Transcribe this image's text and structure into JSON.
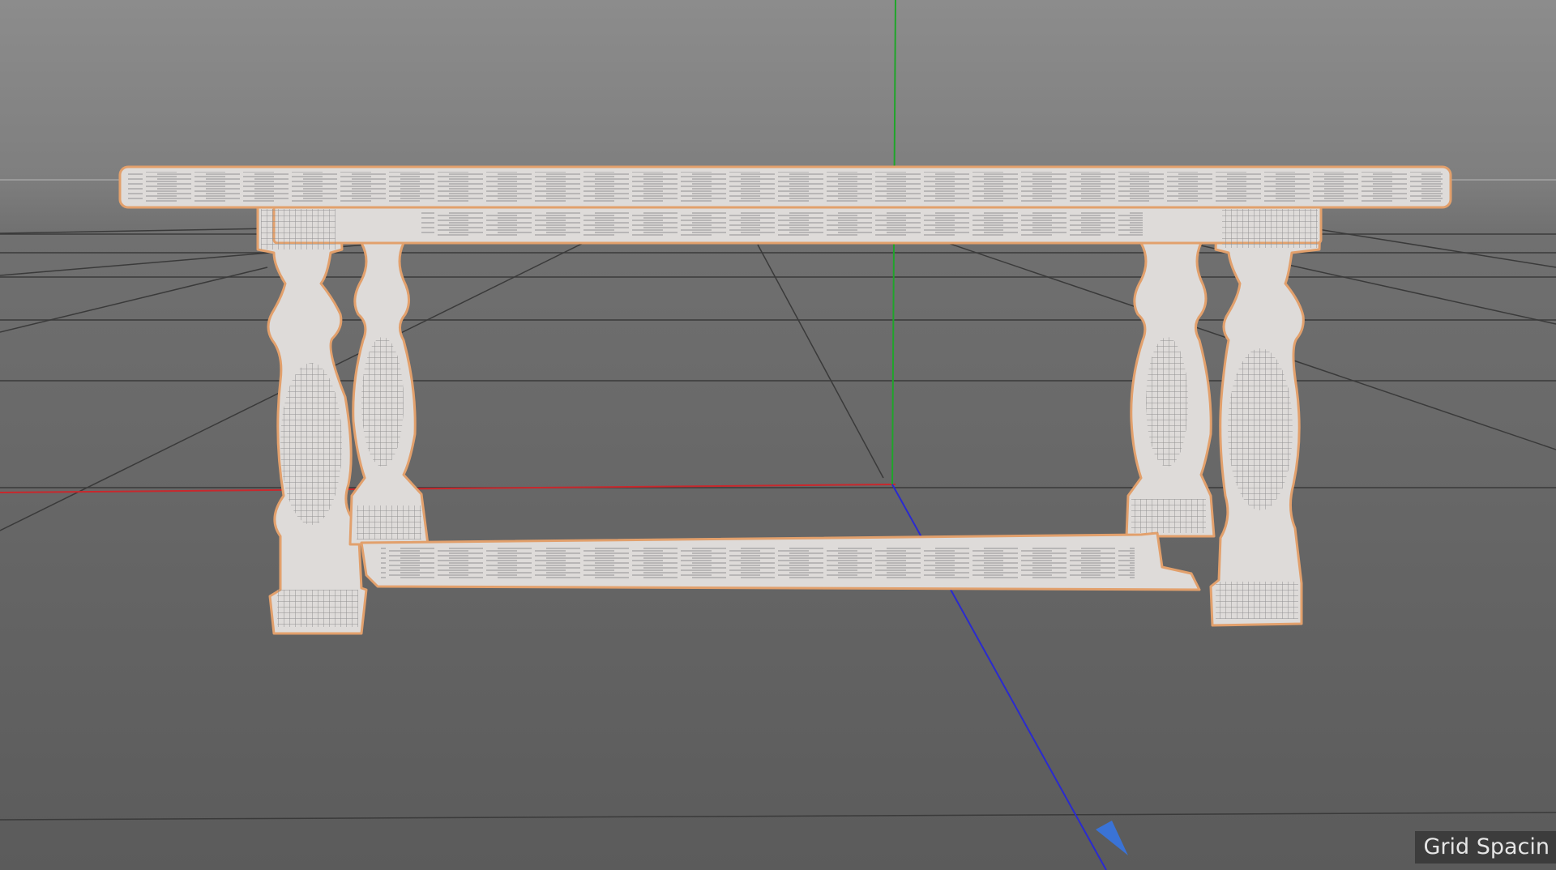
{
  "viewport": {
    "hud": {
      "grid_spacing_label": "Grid Spacin"
    },
    "object": {
      "kind": "table",
      "display": "wireframe",
      "selected": true
    },
    "colors": {
      "background_top": "#8c8c8c",
      "background_bottom": "#5b5b5b",
      "grid_line": "#3a3a3a",
      "x_axis": "#c8282d",
      "y_axis": "#1fa52a",
      "z_axis": "#2a2ad0",
      "model_fill": "#dedbd9",
      "selection_outline": "#e2a06c",
      "wire": "#8a8a8a",
      "light_marker": "#3a73d6"
    }
  }
}
